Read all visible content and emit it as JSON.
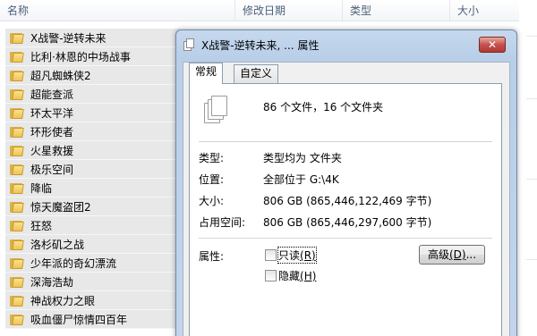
{
  "explorer": {
    "columns": {
      "name": "名称",
      "modified": "修改日期",
      "type": "类型",
      "size": "大小"
    },
    "sort_indicator": "^",
    "folders": [
      "X战警-逆转未来",
      "比利·林恩的中场战事",
      "超凡蜘蛛侠2",
      "超能查派",
      "环太平洋",
      "环形使者",
      "火星救援",
      "极乐空间",
      "降临",
      "惊天魔盗团2",
      "狂怒",
      "洛杉矶之战",
      "少年派的奇幻漂流",
      "深海浩劫",
      "神战权力之眼",
      "吸血僵尸惊情四百年"
    ]
  },
  "dialog": {
    "title": "X战警-逆转未来, ... 属性",
    "close_label": "✕",
    "tabs": [
      "常规",
      "自定义"
    ],
    "summary": "86 个文件，16 个文件夹",
    "properties": {
      "type_label": "类型:",
      "type_value": "类型均为 文件夹",
      "location_label": "位置:",
      "location_value": "全部位于 G:\\4K",
      "size_label": "大小:",
      "size_value": "806 GB (865,446,122,469 字节)",
      "disk_label": "占用空间:",
      "disk_value": "806 GB (865,446,297,600 字节)"
    },
    "attributes": {
      "label": "属性:",
      "readonly_text": "只读",
      "readonly_key": "(R)",
      "hidden_text": "隐藏",
      "hidden_key": "(H)",
      "readonly_checked": false,
      "hidden_checked": false
    },
    "advanced": {
      "text": "高级",
      "key": "(D)",
      "suffix": "..."
    }
  },
  "colors": {
    "dialog_frame": "#b9cfe8",
    "close_button": "#c75050",
    "header_text": "#4c607a",
    "folder": "#eec457"
  }
}
